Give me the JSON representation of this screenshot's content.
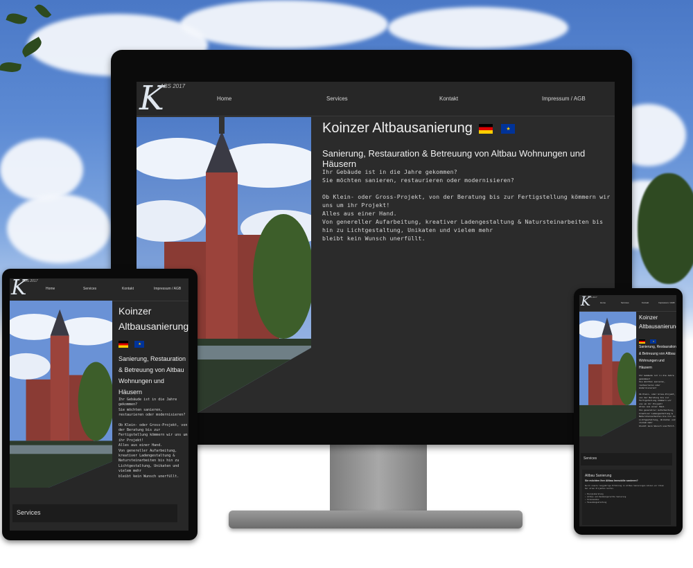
{
  "site": {
    "logo_letter": "K",
    "logo_sub": "ABS 2017",
    "nav": [
      "Home",
      "Services",
      "Kontakt",
      "Impressum / AGB"
    ],
    "title": "Koinzer Altbausanierung",
    "subtitle": "Sanierung, Restauration & Betreuung von Altbau Wohnungen und Häusern",
    "tablet_title": "Koinzer Altbausanierung",
    "tablet_subtitle": "Sanierung, Restauration & Betreuung von Altbau Wohnungen und Häusern",
    "body_p1": "Ihr Gebäude ist in die Jahre gekommen?\nSie möchten sanieren, restaurieren oder modernisieren?",
    "body_p2": "Ob Klein- oder Gross-Projekt, von der Beratung bis zur Fertigstellung kömmern wir uns um ihr Projekt!\nAlles aus einer Hand.\nVon genereller Aufarbeitung, kreativer Ladengestaltung & Natursteinarbeiten bis hin zu Lichtgestaltung, Unikaten und vielem mehr\nbleibt kein Wunsch unerfüllt.",
    "services_label": "Services",
    "card_title": "Altbau Sanierung",
    "card_subtitle": "Sie möchten Ihre Altbau Immobilie sanieren?",
    "card_text": "Durch unsere langjährige Erfahrung in Altbau Sanierungen können wir Ihnen\nbei allen Projekten helfen.\n\n• Energieberatung\n• Altbau und Denkmalgerechte Sanierung\n• Innenausbau\n• Fassadengestaltung"
  },
  "colors": {
    "site_bg": "#2b2b2b",
    "nav_bg": "#272727",
    "text": "#e6e6e6",
    "bezel": "#0b0b0b",
    "stand": "#8f8f8f"
  },
  "icons": [
    "logo-k-icon",
    "flag-germany-icon",
    "flag-eu-icon"
  ]
}
